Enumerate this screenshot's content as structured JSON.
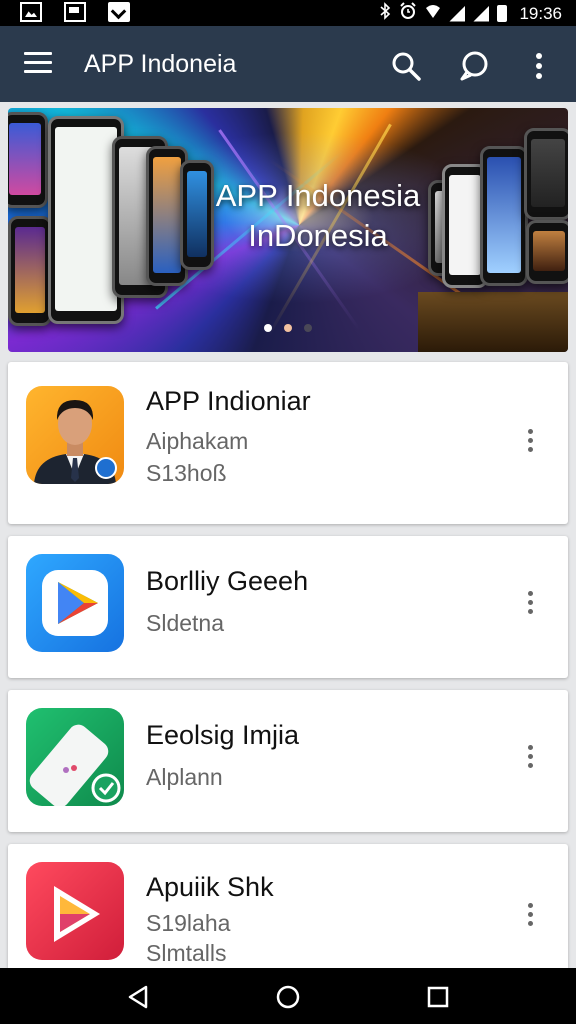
{
  "status_bar": {
    "time": "19:36",
    "icons": [
      "gallery-icon",
      "photo-icon",
      "mail-icon",
      "bluetooth-icon",
      "alarm-icon",
      "wifi-icon",
      "signal-icon",
      "signal-icon",
      "battery-icon"
    ]
  },
  "app_bar": {
    "title": "APP Indoneia"
  },
  "banner": {
    "title_line1": "APP Indonesia",
    "title_line2": "InDonesia",
    "pages": 3,
    "active_page": 0
  },
  "apps": [
    {
      "name": "APP Indioniar",
      "line1": "Aiphakam",
      "line2": "S13hoß",
      "icon": "person-avatar-icon",
      "accent": "#f5a623"
    },
    {
      "name": "Borlliy Geeeh",
      "line1": "Sldetna",
      "line2": "",
      "icon": "play-store-icon",
      "accent": "#1e88e5"
    },
    {
      "name": "Eeolsig Imjia",
      "line1": "Alplann",
      "line2": "",
      "icon": "phone-app-icon",
      "accent": "#1aa260"
    },
    {
      "name": "Apuiik Shk",
      "line1": "S19laha",
      "line2": "Slmtalls",
      "icon": "play-arrow-icon",
      "accent": "#e52d4a"
    }
  ],
  "nav": {
    "icons": [
      "back-icon",
      "home-icon",
      "recents-icon"
    ]
  }
}
